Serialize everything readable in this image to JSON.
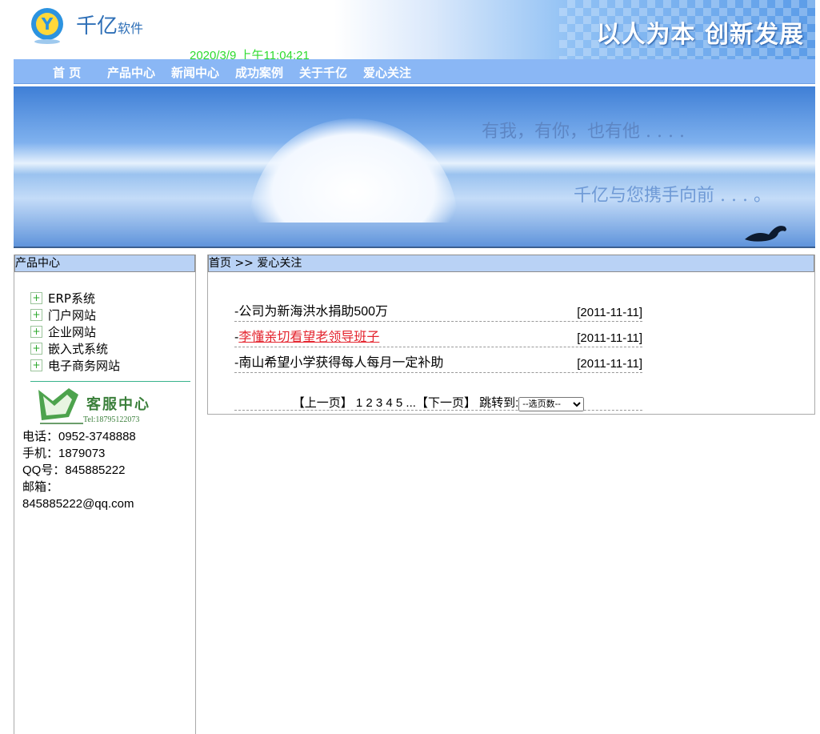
{
  "header": {
    "logo_brand": "千亿",
    "logo_suffix": "软件",
    "datetime": "2020/3/9 上午11:04:21",
    "slogan": "以人为本 创新发展"
  },
  "nav": [
    "首 页",
    "产品中心",
    "新闻中心",
    "成功案例",
    "关于千亿",
    "爱心关注"
  ],
  "banner": {
    "line1": "有我，有你，也有他 . . . .",
    "line2": "千亿与您携手向前 . . . 。"
  },
  "sidebar": {
    "title": "产品中心",
    "products": [
      "ERP系统",
      "门户网站",
      "企业网站",
      "嵌入式系统",
      "电子商务网站"
    ],
    "service_title": "客服中心",
    "service_tel": "Tel:18795122073",
    "contact": {
      "phone": "电话：0952-3748888",
      "mobile": "手机：1879073",
      "qq": "QQ号：845885222",
      "email_label": "邮箱：",
      "email": "845885222@qq.com"
    }
  },
  "main": {
    "breadcrumb": "首页 >> 爱心关注",
    "news": [
      {
        "title": "-公司为新海洪水捐助500万",
        "date": "[2011-11-11]"
      },
      {
        "prefix": "-",
        "title": "李懂亲切看望老领导班子",
        "date": "[2011-11-11]"
      },
      {
        "title": "-南山希望小学获得每人每月一定补助",
        "date": "[2011-11-11]"
      }
    ],
    "pager": {
      "prev": "【上一页】",
      "pages": "1 2 3 4 5 ...",
      "next": "【下一页】",
      "jump_label": "跳转到:",
      "select_value": "--选页数--"
    }
  },
  "colors": {
    "nav_bg": "#8ab7f5",
    "title_bg": "#b9d2f5",
    "link_red": "#e4242e",
    "date_green": "#2fdb2f"
  }
}
